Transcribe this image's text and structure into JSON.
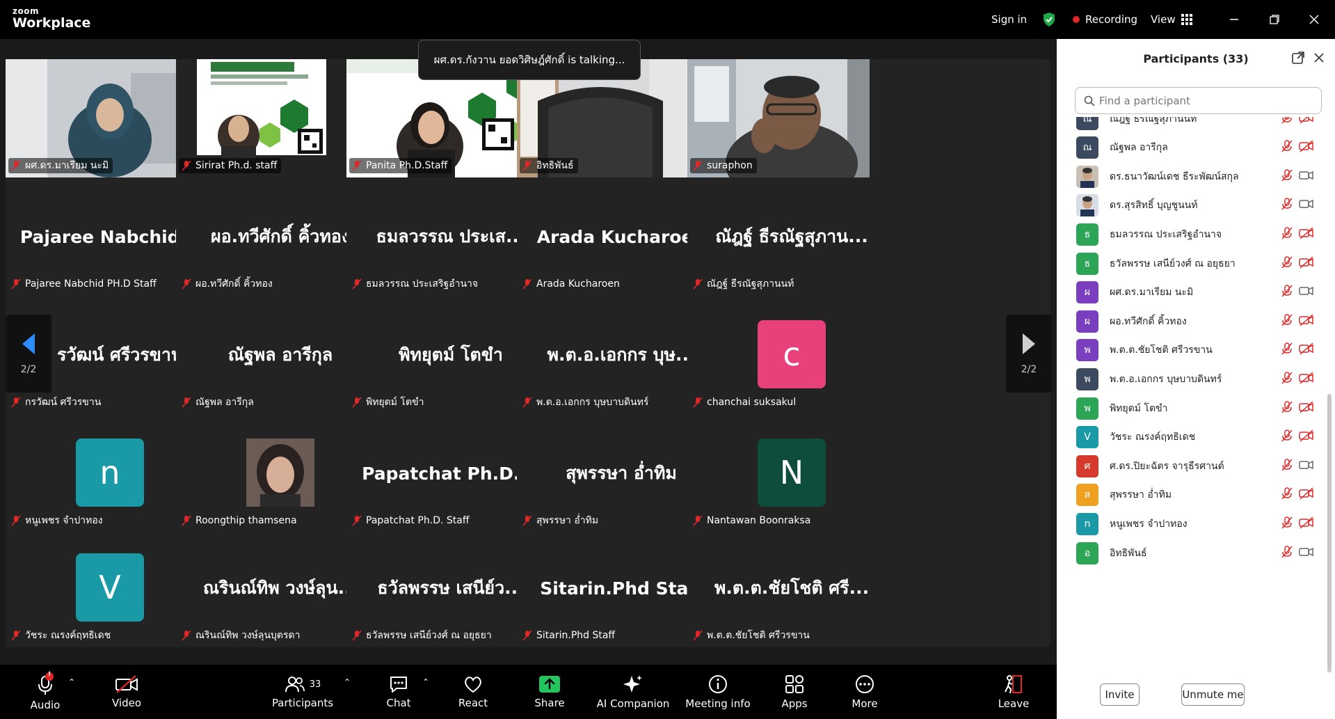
{
  "app": {
    "brand_small": "zoom",
    "brand_large": "Workplace"
  },
  "topbar": {
    "sign_in": "Sign in",
    "recording": "Recording",
    "view": "View"
  },
  "talking": "ผศ.ดร.กังวาน ยอดวิศิษฎ์ศักดิ์ is talking...",
  "pager": {
    "left_page": "2/2",
    "right_page": "2/2"
  },
  "tiles": [
    {
      "label": "ผศ.ดร.มาเรียม นะมิ",
      "big": ""
    },
    {
      "label": "Sirirat Ph.d. staff",
      "big": ""
    },
    {
      "label": "Panita Ph.D.Staff",
      "big": ""
    },
    {
      "label": "อิทธิพันธ์",
      "big": ""
    },
    {
      "label": "suraphon",
      "big": ""
    },
    {
      "label": "Pajaree Nabchid PH.D Staff",
      "big": "Pajaree  Nabchid..."
    },
    {
      "label": "ผอ.ทวีศักดิ์ คิ้วทอง",
      "big": "ผอ.ทวีศักดิ์ คิ้วทอง"
    },
    {
      "label": "ธมลวรรณ ประเสริฐอำนาจ",
      "big": "ธมลวรรณ ประเส..."
    },
    {
      "label": "Arada Kucharoen",
      "big": "Arada Kucharoen"
    },
    {
      "label": "ณัฎฐ์ ธีรณัฐสุภานนท์",
      "big": "ณัฎฐ์ ธีรณัฐสุภาน..."
    },
    {
      "label": "กรวัฒน์ ศรีวรขาน",
      "big": "รวัฒน์ ศรีวรขาน"
    },
    {
      "label": "ณัฐพล อารีกุล",
      "big": "ณัฐพล อารีกุล"
    },
    {
      "label": "พิทยุตม์ โตขำ",
      "big": "พิทยุตม์ โตขำ"
    },
    {
      "label": "พ.ต.อ.เอกกร บุษบาบดินทร์",
      "big": "พ.ต.อ.เอกกร บุษ..."
    },
    {
      "label": "chanchai suksakul",
      "avatar": "c",
      "avatar_color": "#e8407a"
    },
    {
      "label": "หนูเพชร จำปาทอง",
      "avatar": "n",
      "avatar_color": "#1a9aa7"
    },
    {
      "label": "Roongthip thamsena",
      "photo": true
    },
    {
      "label": "Papatchat Ph.D. Staff",
      "big": "Papatchat  Ph.D...."
    },
    {
      "label": "สุพรรษา อ่ำทิม",
      "big": "สุพรรษา อ่ำทิม"
    },
    {
      "label": "Nantawan Boonraksa",
      "avatar": "N",
      "avatar_color": "#0e4d3d"
    },
    {
      "label": "วัชระ ณรงค์ฤทธิเดช",
      "avatar": "V",
      "avatar_color": "#1a9aa7"
    },
    {
      "label": "ณรินณ์ทิพ วงษ์ลุนบุตรดา",
      "big": "ณรินณ์ทิพ วงษ์ลุน..."
    },
    {
      "label": "ธวัลพรรษ เสนีย์วงศ์ ณ อยุธยา",
      "big": "ธวัลพรรษ เสนีย์ว..."
    },
    {
      "label": "Sitarin.Phd Staff",
      "big": "Sitarin.Phd Staff"
    },
    {
      "label": "พ.ต.ต.ชัยโชติ ศรีวรขาน",
      "big": "พ.ต.ต.ชัยโชติ ศรี..."
    }
  ],
  "toolbar": {
    "audio": "Audio",
    "audio_badge": "!",
    "video": "Video",
    "participants": "Participants",
    "participants_count": "33",
    "chat": "Chat",
    "react": "React",
    "share": "Share",
    "ai": "AI Companion",
    "meeting_info": "Meeting info",
    "apps": "Apps",
    "more": "More",
    "leave": "Leave"
  },
  "panel": {
    "title": "Participants (33)",
    "search_placeholder": "Find a participant",
    "invite": "Invite",
    "unmute": "Unmute me",
    "rows": [
      {
        "initial": "ณ",
        "name": "ณัฎฐ์ ธีรณัฐสุภานนท์",
        "color": "#3b4a5e",
        "cam": "off"
      },
      {
        "initial": "ณ",
        "name": "ณัฐพล อารีกุล",
        "color": "#3b4a5e",
        "cam": "off"
      },
      {
        "initial": "",
        "name": "ดร.ธนาวัฒน์เดช ธีระพัฒน์สกุล",
        "color": "#c9c0b5",
        "cam": "on",
        "photo": true
      },
      {
        "initial": "",
        "name": "ดร.สุรสิทธิ์ บุญชูนนท์",
        "color": "#d8dde6",
        "cam": "on",
        "photo": true
      },
      {
        "initial": "ธ",
        "name": "ธมลวรรณ ประเสริฐอำนาจ",
        "color": "#2ca556",
        "cam": "off"
      },
      {
        "initial": "ธ",
        "name": "ธวัลพรรษ เสนีย์วงศ์ ณ อยุธยา",
        "color": "#2ca556",
        "cam": "off"
      },
      {
        "initial": "ผ",
        "name": "ผศ.ดร.มาเรียม นะมิ",
        "color": "#7a3fbf",
        "cam": "on"
      },
      {
        "initial": "ผ",
        "name": "ผอ.ทวีศักดิ์ คิ้วทอง",
        "color": "#7a3fbf",
        "cam": "off"
      },
      {
        "initial": "พ",
        "name": "พ.ต.ต.ชัยโชติ ศรีวรขาน",
        "color": "#7a3fbf",
        "cam": "off"
      },
      {
        "initial": "พ",
        "name": "พ.ต.อ.เอกกร บุษบาบดินทร์",
        "color": "#3b4a5e",
        "cam": "off"
      },
      {
        "initial": "พ",
        "name": "พิทยุตม์ โตขำ",
        "color": "#2ca556",
        "cam": "off"
      },
      {
        "initial": "V",
        "name": "วัชระ ณรงค์ฤทธิเดช",
        "color": "#1a9aa7",
        "cam": "off"
      },
      {
        "initial": "ศ",
        "name": "ศ.ดร.ปิยะฉัตร จารุธีรศานต์",
        "color": "#d63a2c",
        "cam": "on"
      },
      {
        "initial": "ส",
        "name": "สุพรรษา อ่ำทิม",
        "color": "#f0a020",
        "cam": "off"
      },
      {
        "initial": "n",
        "name": "หนูเพชร จำปาทอง",
        "color": "#1a9aa7",
        "cam": "off"
      },
      {
        "initial": "อ",
        "name": "อิทธิพันธ์",
        "color": "#2ca556",
        "cam": "on"
      }
    ]
  },
  "colors": {
    "accent_blue": "#0b5cff",
    "muted_red": "#e02828",
    "share_green": "#22c55e",
    "shield_green": "#1fa84a"
  }
}
